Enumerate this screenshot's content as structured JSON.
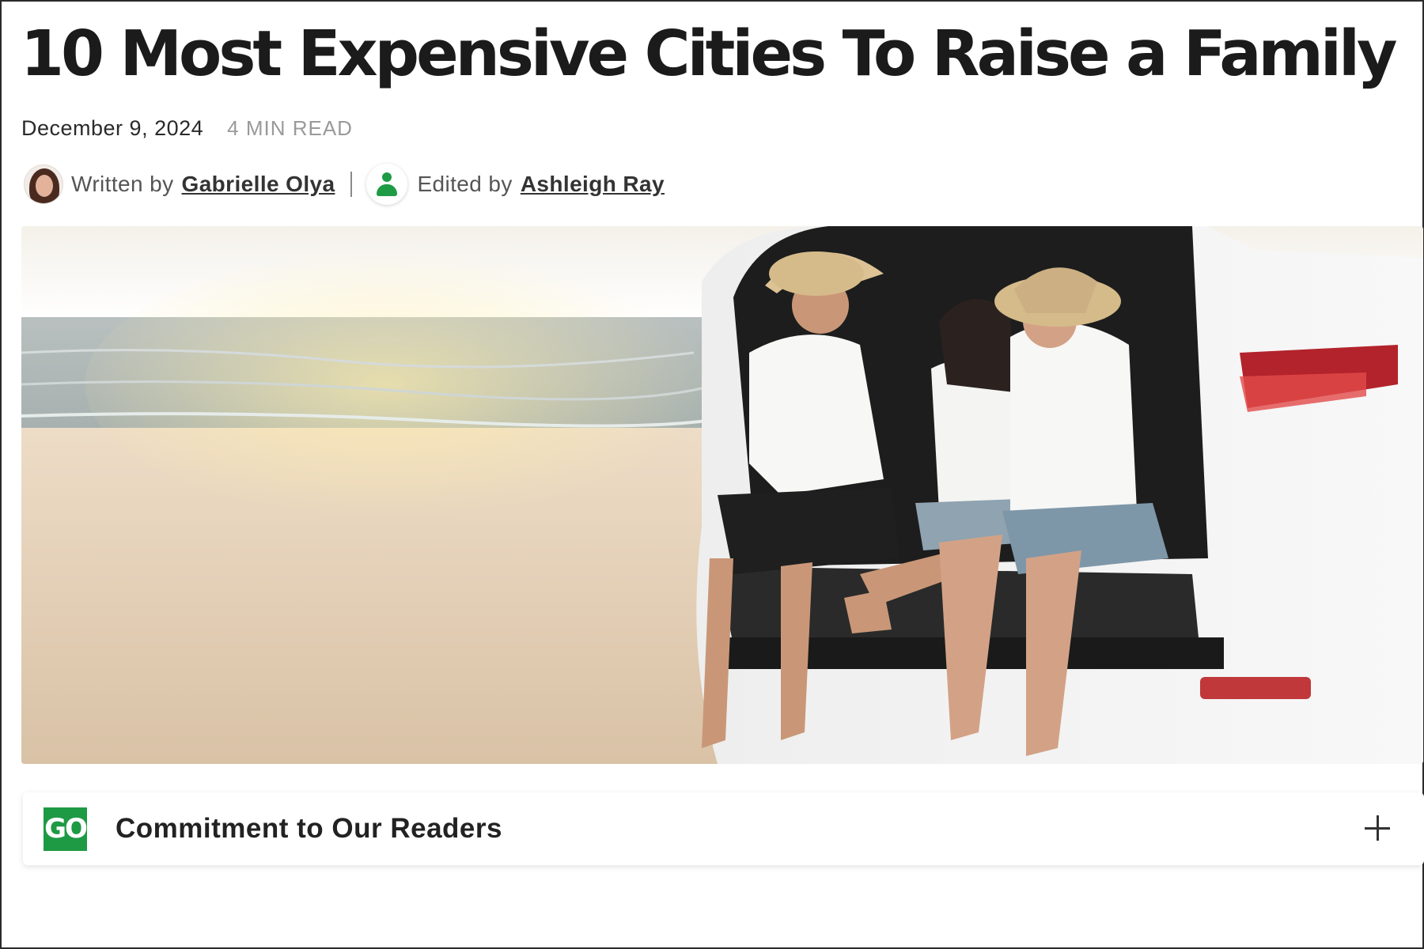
{
  "article": {
    "title": "10 Most Expensive Cities To Raise a Family",
    "date": "December 9, 2024",
    "read_time": "4 MIN READ"
  },
  "byline": {
    "written_label": "Written by",
    "author": "Gabrielle Olya",
    "edited_label": "Edited by",
    "editor": "Ashleigh Ray"
  },
  "hero_image": {
    "icon": "photo-family-car-beach"
  },
  "commitment": {
    "logo_text": "GO",
    "title": "Commitment to Our Readers",
    "expand_icon": "plus-icon"
  },
  "colors": {
    "brand_green": "#1e9a44",
    "text_dark": "#1b1b1b",
    "text_muted": "#9a9a9a"
  }
}
